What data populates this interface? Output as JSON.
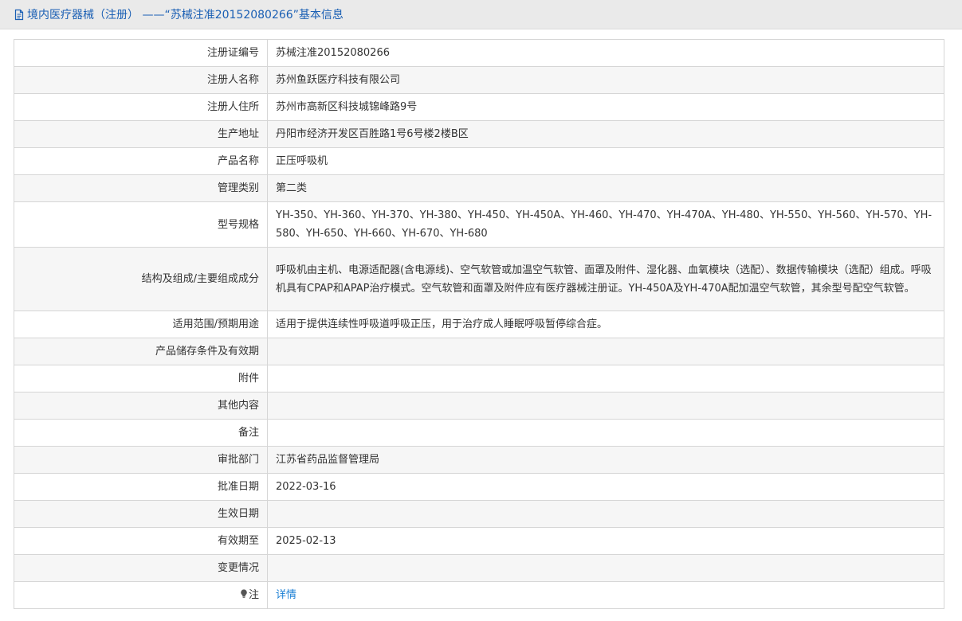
{
  "header": {
    "title": "境内医疗器械（注册） ——“苏械注准20152080266”基本信息"
  },
  "rows": [
    {
      "label": "注册证编号",
      "value": "苏械注准20152080266"
    },
    {
      "label": "注册人名称",
      "value": "苏州鱼跃医疗科技有限公司"
    },
    {
      "label": "注册人住所",
      "value": "苏州市高新区科技城锦峰路9号"
    },
    {
      "label": "生产地址",
      "value": "丹阳市经济开发区百胜路1号6号楼2楼B区"
    },
    {
      "label": "产品名称",
      "value": "正压呼吸机"
    },
    {
      "label": "管理类别",
      "value": "第二类"
    },
    {
      "label": "型号规格",
      "value": "YH-350、YH-360、YH-370、YH-380、YH-450、YH-450A、YH-460、YH-470、YH-470A、YH-480、YH-550、YH-560、YH-570、YH-580、YH-650、YH-660、YH-670、YH-680"
    },
    {
      "label": "结构及组成/主要组成成分",
      "value": "呼吸机由主机、电源适配器(含电源线)、空气软管或加温空气软管、面罩及附件、湿化器、血氧模块（选配）、数据传输模块（选配）组成。呼吸机具有CPAP和APAP治疗模式。空气软管和面罩及附件应有医疗器械注册证。YH-450A及YH-470A配加温空气软管，其余型号配空气软管。"
    },
    {
      "label": "适用范围/预期用途",
      "value": "适用于提供连续性呼吸道呼吸正压，用于治疗成人睡眠呼吸暂停综合症。"
    },
    {
      "label": "产品储存条件及有效期",
      "value": ""
    },
    {
      "label": "附件",
      "value": ""
    },
    {
      "label": "其他内容",
      "value": ""
    },
    {
      "label": "备注",
      "value": ""
    },
    {
      "label": "审批部门",
      "value": "江苏省药品监督管理局"
    },
    {
      "label": "批准日期",
      "value": "2022-03-16"
    },
    {
      "label": "生效日期",
      "value": ""
    },
    {
      "label": "有效期至",
      "value": "2025-02-13"
    },
    {
      "label": "变更情况",
      "value": ""
    }
  ],
  "note": {
    "label": "注",
    "link": "详情",
    "icon": "lightbulb-icon"
  },
  "colors": {
    "title": "#1a5fb4",
    "link": "#1a7fd4",
    "border": "#d6d6d6",
    "stripe": "#f6f6f6"
  }
}
